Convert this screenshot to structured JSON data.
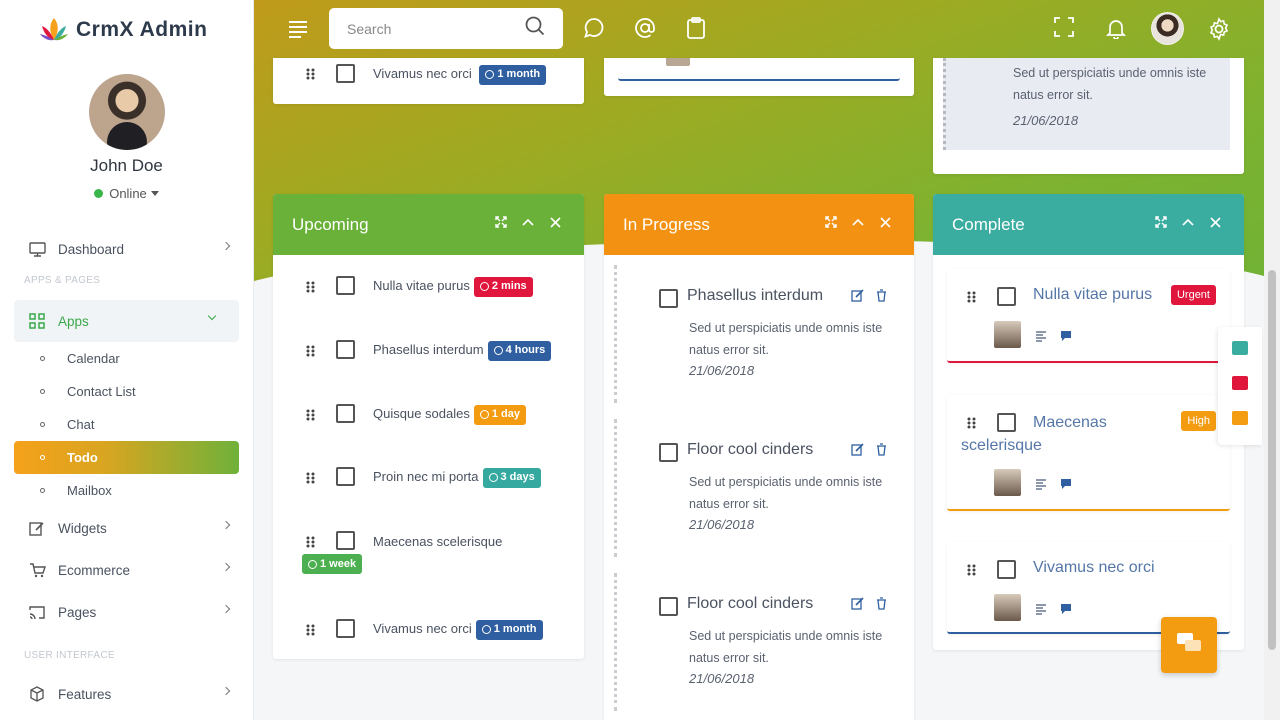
{
  "brand": {
    "name": "CrmX Admin"
  },
  "profile": {
    "name": "John Doe",
    "status": "Online"
  },
  "menu": {
    "dashboard": "Dashboard",
    "section_apps": "APPS & PAGES",
    "apps": "Apps",
    "apps_sub": [
      "Calendar",
      "Contact List",
      "Chat",
      "Todo",
      "Mailbox"
    ],
    "widgets": "Widgets",
    "ecommerce": "Ecommerce",
    "pages": "Pages",
    "section_ui": "USER INTERFACE",
    "features": "Features"
  },
  "topbar": {
    "search_placeholder": "Search"
  },
  "top_fragments": {
    "left_item": {
      "text": "Vivamus nec orci",
      "badge": "1 month"
    },
    "right_item": {
      "desc": "Sed ut perspiciatis unde omnis iste natus error sit.",
      "date": "21/06/2018"
    }
  },
  "upcoming": {
    "title": "Upcoming",
    "items": [
      {
        "text": "Nulla vitae purus",
        "badge": "2 mins",
        "color": "#e0163d"
      },
      {
        "text": "Phasellus interdum",
        "badge": "4 hours",
        "color": "#2f5fa0"
      },
      {
        "text": "Quisque sodales",
        "badge": "1 day",
        "color": "#f39c12"
      },
      {
        "text": "Proin nec mi porta",
        "badge": "3 days",
        "color": "#35a9a0"
      },
      {
        "text": "Maecenas scelerisque",
        "badge": "1 week",
        "color": "#4caf50"
      },
      {
        "text": "Vivamus nec orci",
        "badge": "1 month",
        "color": "#2f5fa0"
      }
    ]
  },
  "in_progress": {
    "title": "In Progress",
    "items": [
      {
        "title": "Phasellus interdum",
        "desc": "Sed ut perspiciatis unde omnis iste natus error sit.",
        "date": "21/06/2018"
      },
      {
        "title": "Floor cool cinders",
        "desc": "Sed ut perspiciatis unde omnis iste natus error sit.",
        "date": "21/06/2018"
      },
      {
        "title": "Floor cool cinders",
        "desc": "Sed ut perspiciatis unde omnis iste natus error sit.",
        "date": "21/06/2018"
      }
    ]
  },
  "complete": {
    "title": "Complete",
    "items": [
      {
        "title": "Nulla vitae purus",
        "priority": "Urgent",
        "priority_color": "#e0163d"
      },
      {
        "title": "Maecenas scelerisque",
        "priority": "High",
        "priority_color": "#f39c12"
      },
      {
        "title": "Vivamus nec orci",
        "priority": ""
      }
    ]
  },
  "colors": {
    "upcoming": "#6ab13a",
    "in_progress": "#f39212",
    "complete": "#3aada0"
  }
}
